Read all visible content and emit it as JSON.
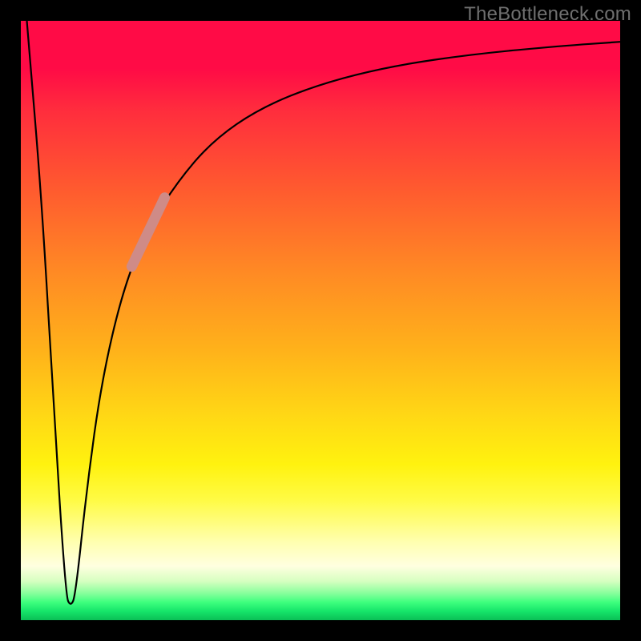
{
  "watermark": "TheBottleneck.com",
  "chart_data": {
    "type": "line",
    "title": "",
    "xlabel": "",
    "ylabel": "",
    "x_range": [
      0,
      100
    ],
    "y_range": [
      0,
      100
    ],
    "gradient_stops": [
      {
        "pos": 0,
        "color": "#ff0b46"
      },
      {
        "pos": 8,
        "color": "#ff0b46"
      },
      {
        "pos": 15,
        "color": "#ff2d3d"
      },
      {
        "pos": 28,
        "color": "#ff5a2f"
      },
      {
        "pos": 42,
        "color": "#ff8a24"
      },
      {
        "pos": 55,
        "color": "#ffb21a"
      },
      {
        "pos": 66,
        "color": "#ffd815"
      },
      {
        "pos": 74,
        "color": "#fff20f"
      },
      {
        "pos": 80,
        "color": "#fffb45"
      },
      {
        "pos": 87,
        "color": "#ffffb0"
      },
      {
        "pos": 91,
        "color": "#ffffe0"
      },
      {
        "pos": 93.5,
        "color": "#d6ffc0"
      },
      {
        "pos": 95.5,
        "color": "#88ff9c"
      },
      {
        "pos": 97,
        "color": "#3eff7e"
      },
      {
        "pos": 98.5,
        "color": "#16e56a"
      },
      {
        "pos": 100,
        "color": "#0abf55"
      }
    ],
    "series": [
      {
        "name": "bottleneck-curve",
        "color": "#000000",
        "width": 2.2,
        "points": [
          {
            "x": 1.0,
            "y": 100.0
          },
          {
            "x": 3.5,
            "y": 70.0
          },
          {
            "x": 5.5,
            "y": 35.0
          },
          {
            "x": 7.5,
            "y": 4.0
          },
          {
            "x": 8.3,
            "y": 2.3
          },
          {
            "x": 9.1,
            "y": 4.0
          },
          {
            "x": 11.0,
            "y": 22.0
          },
          {
            "x": 13.5,
            "y": 40.0
          },
          {
            "x": 17.0,
            "y": 55.0
          },
          {
            "x": 21.0,
            "y": 65.0
          },
          {
            "x": 26.0,
            "y": 73.0
          },
          {
            "x": 32.0,
            "y": 80.0
          },
          {
            "x": 40.0,
            "y": 85.5
          },
          {
            "x": 50.0,
            "y": 89.5
          },
          {
            "x": 62.0,
            "y": 92.5
          },
          {
            "x": 76.0,
            "y": 94.5
          },
          {
            "x": 90.0,
            "y": 95.8
          },
          {
            "x": 100.0,
            "y": 96.5
          }
        ]
      },
      {
        "name": "highlight-segment",
        "color": "#cf8b87",
        "width": 13,
        "points": [
          {
            "x": 18.5,
            "y": 59.0
          },
          {
            "x": 24.0,
            "y": 70.5
          }
        ]
      }
    ]
  }
}
